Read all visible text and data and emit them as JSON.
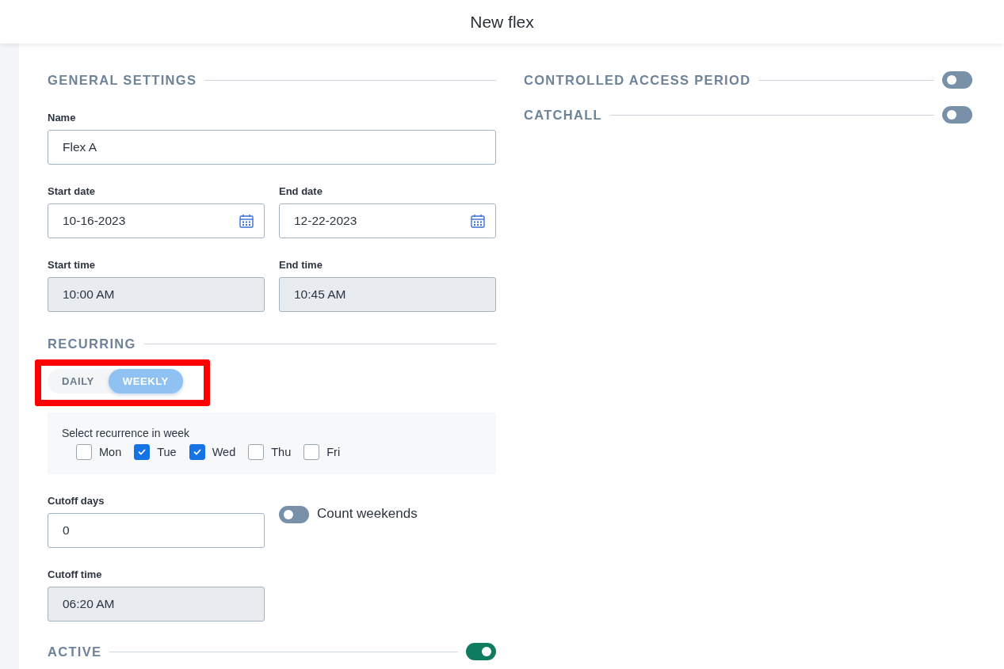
{
  "header": {
    "title": "New flex"
  },
  "general": {
    "heading": "GENERAL SETTINGS",
    "rows": [
      [
        {
          "label": "Name",
          "value": "Flex A",
          "kind": "text",
          "disabled": false
        }
      ],
      [
        {
          "label": "Start date",
          "value": "10-16-2023",
          "kind": "date",
          "disabled": false
        },
        {
          "label": "End date",
          "value": "12-22-2023",
          "kind": "date",
          "disabled": false
        }
      ],
      [
        {
          "label": "Start time",
          "value": "10:00 AM",
          "kind": "text",
          "disabled": true
        },
        {
          "label": "End time",
          "value": "10:45 AM",
          "kind": "text",
          "disabled": true
        }
      ]
    ]
  },
  "recurring": {
    "heading": "RECURRING",
    "highlighted": true,
    "modes": [
      {
        "label": "DAILY",
        "selected": false
      },
      {
        "label": "WEEKLY",
        "selected": true
      }
    ],
    "week": {
      "prompt": "Select recurrence in week",
      "days": [
        {
          "label": "Mon",
          "checked": false
        },
        {
          "label": "Tue",
          "checked": true
        },
        {
          "label": "Wed",
          "checked": true
        },
        {
          "label": "Thu",
          "checked": false
        },
        {
          "label": "Fri",
          "checked": false
        }
      ]
    },
    "cutoff_days": {
      "label": "Cutoff days",
      "value": "0",
      "disabled": false
    },
    "count_weekends": {
      "label": "Count weekends",
      "on": false
    },
    "cutoff_time": {
      "label": "Cutoff time",
      "value": "06:20 AM",
      "disabled": true
    }
  },
  "active": {
    "heading": "ACTIVE",
    "on": true
  },
  "side_sections": [
    {
      "heading": "CONTROLLED ACCESS PERIOD",
      "on": false
    },
    {
      "heading": "CATCHALL",
      "on": false
    }
  ]
}
